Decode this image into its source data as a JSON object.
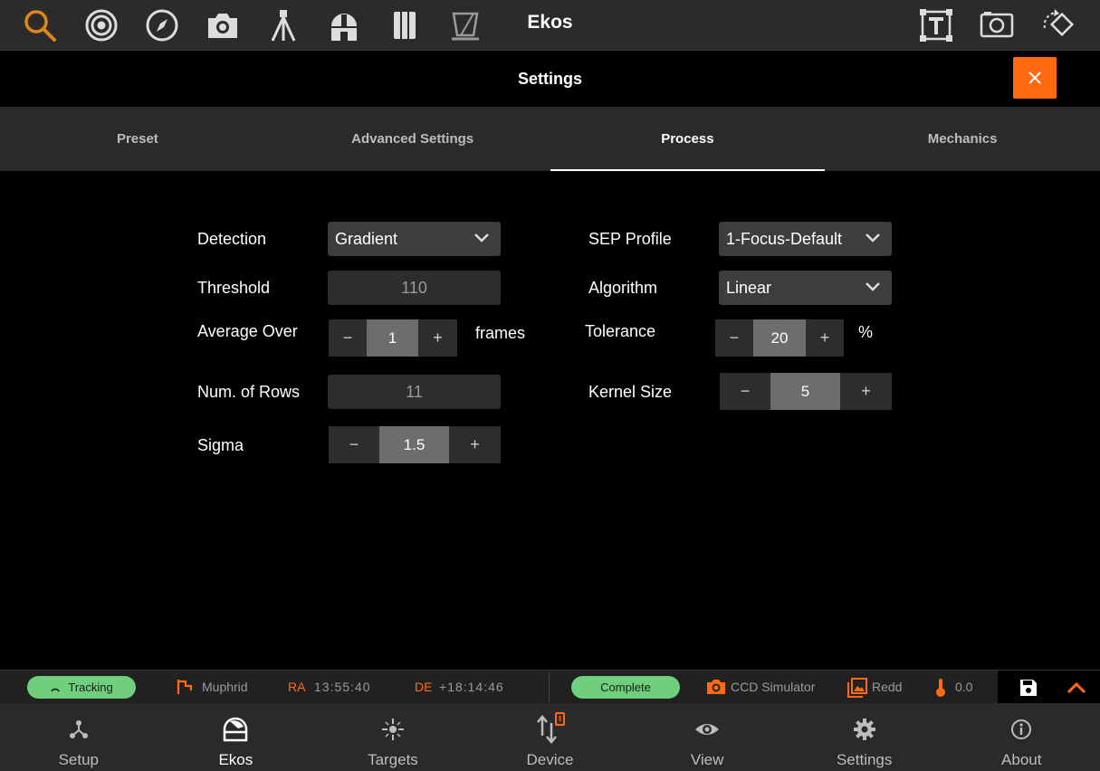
{
  "app": {
    "title": "Ekos"
  },
  "settings": {
    "title": "Settings"
  },
  "tabs": [
    {
      "label": "Preset"
    },
    {
      "label": "Advanced Settings"
    },
    {
      "label": "Process"
    },
    {
      "label": "Mechanics"
    }
  ],
  "form": {
    "detection": {
      "label": "Detection",
      "value": "Gradient"
    },
    "threshold": {
      "label": "Threshold",
      "value": "110"
    },
    "average_over": {
      "label": "Average Over",
      "value": "1",
      "unit": "frames"
    },
    "num_rows": {
      "label": "Num. of Rows",
      "value": "11"
    },
    "sigma": {
      "label": "Sigma",
      "value": "1.5"
    },
    "sep_profile": {
      "label": "SEP Profile",
      "value": "1-Focus-Default"
    },
    "algorithm": {
      "label": "Algorithm",
      "value": "Linear"
    },
    "tolerance": {
      "label": "Tolerance",
      "value": "20",
      "unit": "%"
    },
    "kernel_size": {
      "label": "Kernel Size",
      "value": "5"
    }
  },
  "spin": {
    "minus": "−",
    "plus": "+"
  },
  "status": {
    "tracking": "Tracking",
    "target": "Muphrid",
    "ra_label": "RA",
    "ra_value": "13:55:40",
    "de_label": "DE",
    "de_value": "+18:14:46",
    "complete": "Complete",
    "camera": "CCD Simulator",
    "filter": "Redd",
    "temperature": "0.0"
  },
  "bottomnav": [
    {
      "label": "Setup"
    },
    {
      "label": "Ekos"
    },
    {
      "label": "Targets"
    },
    {
      "label": "Device"
    },
    {
      "label": "View"
    },
    {
      "label": "Settings"
    },
    {
      "label": "About"
    }
  ],
  "colors": {
    "accent": "#ff6a13",
    "success": "#6fcf7d",
    "panel": "#2a2a2a"
  }
}
